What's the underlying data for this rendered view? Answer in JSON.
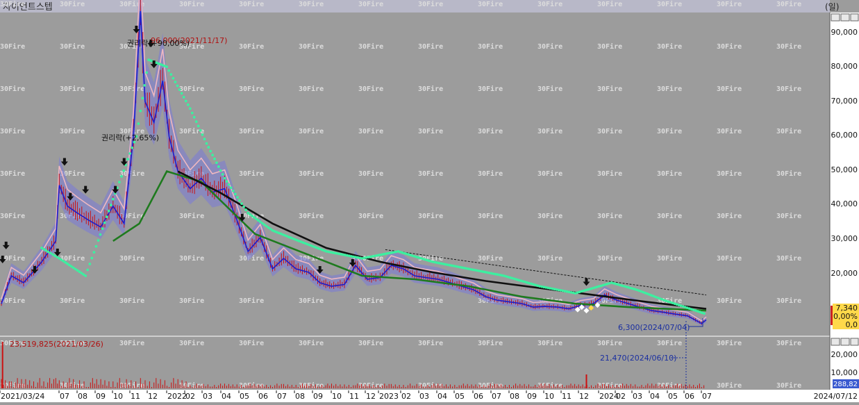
{
  "window": {
    "title": "자이언트스텝",
    "period": "(일)"
  },
  "watermark": "30Fire",
  "price_axis": {
    "ticks": [
      "90,000",
      "80,000",
      "70,000",
      "60,000",
      "50,000",
      "40,000",
      "30,000",
      "20,000"
    ]
  },
  "volume_axis": {
    "ticks": [
      "20,000",
      "10,000"
    ],
    "current_value": "288,82"
  },
  "side_buttons": [
    "□",
    "□",
    "□"
  ],
  "current_box": {
    "price": "7,340",
    "change": "0,00%",
    "volume": "0,0"
  },
  "annotations": {
    "high": "96,000(2021/11/17)",
    "rights1": "권리락(+90,00%)",
    "rights2": "권리락(+2,65%)",
    "low": "6,300(2024/07/04)",
    "volume_label": "21,470(2024/06/10)",
    "volume_max": "23,519,825(2021/03/26)"
  },
  "x_axis": {
    "labels": [
      "2021/03/24",
      "07",
      "08",
      "09",
      "10",
      "11",
      "12",
      "2022",
      "02",
      "03",
      "04",
      "05",
      "06",
      "07",
      "08",
      "09",
      "10",
      "11",
      "12",
      "2023",
      "02",
      "03",
      "04",
      "05",
      "06",
      "07",
      "08",
      "09",
      "10",
      "11",
      "12",
      "2024",
      "02",
      "03",
      "04",
      "05",
      "06",
      "07"
    ],
    "end_label": "2024/07/12"
  },
  "colors": {
    "background": "#9c9c9c",
    "price_line": "#1c1ccc",
    "candles": "#cc1111",
    "ma_black": "#101010",
    "ma_green": "#1e7a1e",
    "trail_mint": "#3cf0a0",
    "envelope_pink": "#f0b8c0",
    "cloud": "#7a7ad8"
  },
  "chart_data": {
    "type": "line",
    "title": "자이언트스텝",
    "y_unit": "KRW",
    "ylim": [
      0,
      95000
    ],
    "x_range": [
      "2021-03-24",
      "2024-07-12"
    ],
    "series": [
      {
        "key": "close",
        "x": [
          "2021-03-24",
          "2021-04-10",
          "2021-05-01",
          "2021-06-01",
          "2021-06-25",
          "2021-07-01",
          "2021-07-15",
          "2021-08-01",
          "2021-08-20",
          "2021-09-10",
          "2021-10-01",
          "2021-10-20",
          "2021-11-05",
          "2021-11-17",
          "2021-11-25",
          "2021-12-10",
          "2021-12-25",
          "2022-01-05",
          "2022-01-20",
          "2022-02-10",
          "2022-03-01",
          "2022-03-20",
          "2022-04-10",
          "2022-05-01",
          "2022-05-20",
          "2022-06-10",
          "2022-07-01",
          "2022-07-20",
          "2022-08-10",
          "2022-09-01",
          "2022-09-20",
          "2022-10-10",
          "2022-11-01",
          "2022-11-20",
          "2022-12-10",
          "2023-01-01",
          "2023-01-20",
          "2023-02-10",
          "2023-03-01",
          "2023-03-20",
          "2023-04-10",
          "2023-05-01",
          "2023-05-20",
          "2023-06-10",
          "2023-07-01",
          "2023-07-20",
          "2023-08-10",
          "2023-09-01",
          "2023-09-20",
          "2023-10-10",
          "2023-11-01",
          "2023-11-20",
          "2023-12-10",
          "2024-01-01",
          "2024-01-20",
          "2024-02-10",
          "2024-03-01",
          "2024-03-20",
          "2024-04-10",
          "2024-05-01",
          "2024-05-20",
          "2024-06-10",
          "2024-07-04",
          "2024-07-12"
        ],
        "values": [
          12000,
          20000,
          18000,
          24000,
          30000,
          46000,
          40000,
          38000,
          36000,
          34000,
          40000,
          35000,
          60000,
          96000,
          70000,
          64000,
          76000,
          60000,
          50000,
          45000,
          48000,
          44000,
          45000,
          36000,
          27000,
          31000,
          22000,
          25000,
          22000,
          21000,
          18000,
          17000,
          17500,
          23000,
          19000,
          19500,
          23000,
          22000,
          20000,
          19500,
          19000,
          18000,
          17000,
          16000,
          14000,
          13000,
          12500,
          12000,
          11000,
          11200,
          11000,
          10500,
          11500,
          12000,
          14500,
          13000,
          12000,
          11000,
          10000,
          9500,
          9000,
          8500,
          6300,
          7340
        ]
      },
      {
        "key": "ma_long",
        "x": [
          "2022-01-20",
          "2022-04-01",
          "2022-07-01",
          "2022-10-01",
          "2023-01-01",
          "2023-04-01",
          "2023-07-01",
          "2023-10-01",
          "2024-01-01",
          "2024-04-01",
          "2024-07-12"
        ],
        "values": [
          50000,
          44000,
          35000,
          28000,
          24000,
          21000,
          18500,
          16500,
          14500,
          12500,
          10500
        ]
      },
      {
        "key": "ma_mid",
        "x": [
          "2021-10-01",
          "2021-11-15",
          "2022-01-01",
          "2022-03-01",
          "2022-06-01",
          "2022-09-01",
          "2022-12-01",
          "2023-03-01",
          "2023-06-01",
          "2023-09-01",
          "2023-12-01",
          "2024-03-01",
          "2024-07-12"
        ],
        "values": [
          30000,
          35000,
          50000,
          47000,
          32000,
          26000,
          20000,
          19000,
          17000,
          14000,
          12000,
          11000,
          10000
        ]
      },
      {
        "key": "trail",
        "x": [
          "2021-06-01",
          "2021-07-01",
          "2021-08-15",
          "2021-10-01",
          "2021-11-10",
          "2021-12-01",
          "2022-01-01",
          "2022-02-10",
          "2022-03-10",
          "2022-04-10",
          "2022-05-20",
          "2022-07-01",
          "2022-08-15",
          "2022-10-01",
          "2022-12-01",
          "2023-02-01",
          "2023-04-01",
          "2023-06-01",
          "2023-08-01",
          "2023-10-01",
          "2023-12-01",
          "2024-02-01",
          "2024-03-15",
          "2024-05-01",
          "2024-07-12"
        ],
        "values": [
          28000,
          25000,
          20000,
          42000,
          60000,
          82000,
          80000,
          68000,
          58000,
          48000,
          38000,
          33000,
          30000,
          27000,
          25000,
          27000,
          24000,
          22000,
          20000,
          17000,
          15000,
          18000,
          16000,
          13000,
          9000
        ]
      }
    ]
  }
}
